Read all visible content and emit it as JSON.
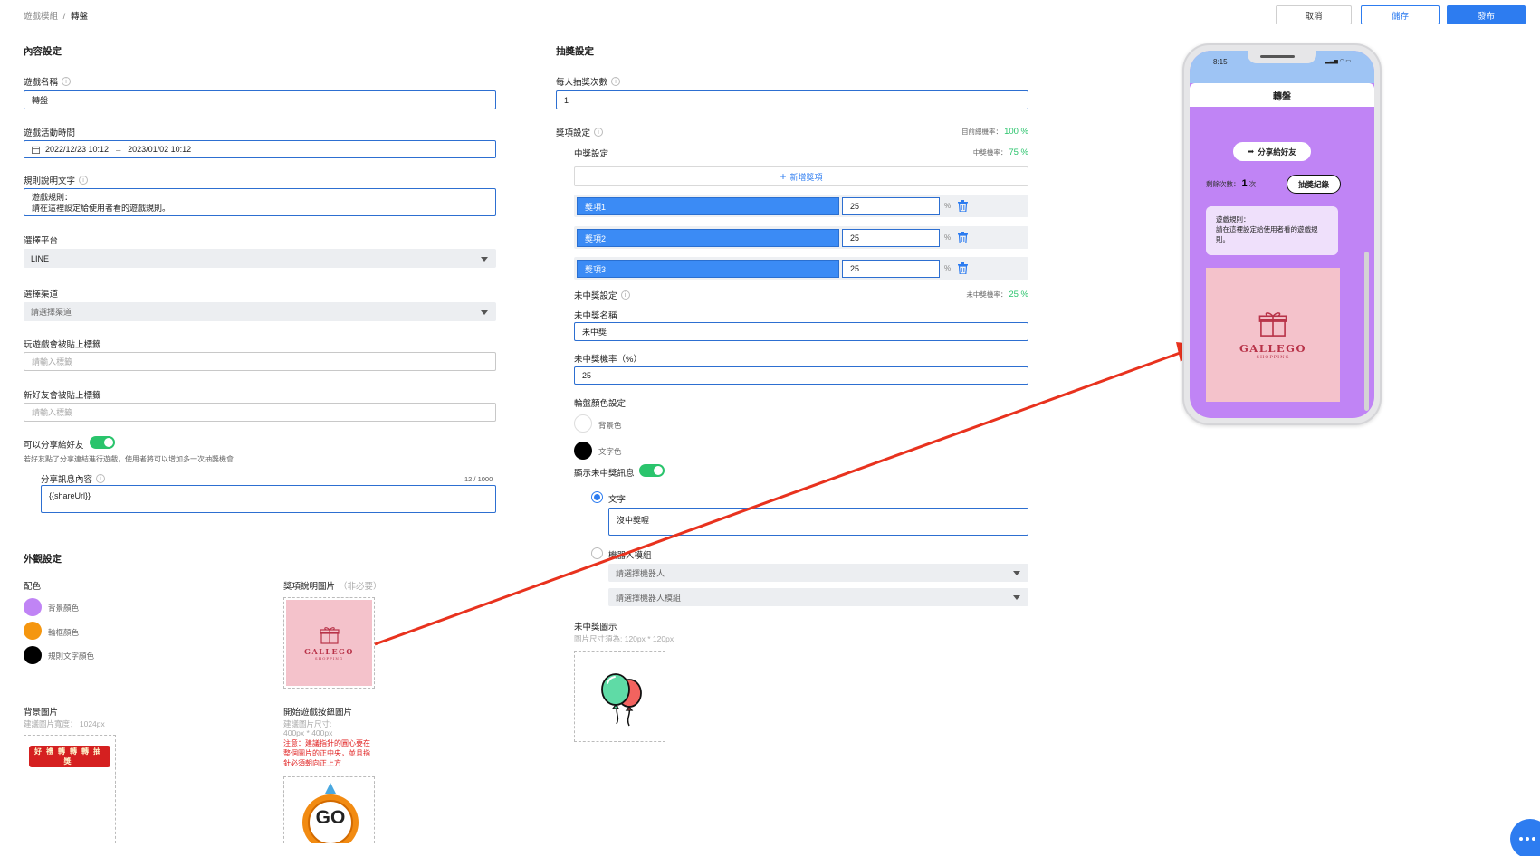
{
  "breadcrumb": {
    "parent": "遊戲模組",
    "separator": "/",
    "current": "轉盤"
  },
  "toolbar": {
    "cancel": "取消",
    "save": "儲存",
    "publish": "發布"
  },
  "content": {
    "section_title": "內容設定",
    "game_name_label": "遊戲名稱",
    "game_name_value": "轉盤",
    "period_label": "遊戲活動時間",
    "period_start": "2022/12/23 10:12",
    "period_arrow": "→",
    "period_end": "2023/01/02 10:12",
    "rules_label": "規則說明文字",
    "rules_line1": "遊戲規則：",
    "rules_line2": "請在這裡設定給使用者看的遊戲規則。",
    "platform_label": "選擇平台",
    "platform_value": "LINE",
    "channel_label": "選擇渠道",
    "channel_placeholder": "請選擇渠道",
    "play_tag_label": "玩遊戲會被貼上標籤",
    "play_tag_placeholder": "請輸入標籤",
    "friend_tag_label": "新好友會被貼上標籤",
    "friend_tag_placeholder": "請輸入標籤",
    "share_label": "可以分享給好友",
    "share_hint": "若好友點了分享連結進行遊戲，使用者將可以增加多一次抽獎機會",
    "share_msg_label": "分享訊息內容",
    "share_msg_count": "12 / 1000",
    "share_msg_value": "{{shareUrl}}"
  },
  "appearance": {
    "section_title": "外觀設定",
    "color_label": "配色",
    "colors": [
      {
        "name": "背景顏色",
        "hex": "#c084f5"
      },
      {
        "name": "輪框顏色",
        "hex": "#f5960f"
      },
      {
        "name": "規則文字顏色",
        "hex": "#000000"
      }
    ],
    "prize_img_label": "獎項說明圖片",
    "prize_img_optional": "（非必要）",
    "bg_img_label": "背景圖片",
    "bg_img_hint": "建議圖片寬度： 1024px",
    "start_btn_label": "開始遊戲按鈕圖片",
    "start_btn_hint1": "建議圖片尺寸:",
    "start_btn_hint2": "400px * 400px",
    "start_btn_note": "注意：建議指針的圓心要在整個圖片的正中央，並且指針必須朝向正上方",
    "gallego_name": "GALLEGO",
    "gallego_sub": "SHOPPING",
    "go_text": "GO",
    "bg_banner": "好禮轉轉轉抽獎"
  },
  "draw": {
    "section_title": "抽獎設定",
    "times_label": "每人抽獎次數",
    "times_value": "1",
    "prize_label": "獎項設定",
    "total_rate_label": "目前總機率：",
    "total_rate_value": "100 %",
    "win_label": "中獎設定",
    "win_rate_label": "中獎機率：",
    "win_rate_value": "75 %",
    "add_prize": "新增獎項",
    "prizes": [
      {
        "name": "獎項1",
        "rate": "25"
      },
      {
        "name": "獎項2",
        "rate": "25"
      },
      {
        "name": "獎項3",
        "rate": "25"
      }
    ],
    "percent": "%",
    "lose_label": "未中獎設定",
    "lose_rate_label": "未中獎機率：",
    "lose_rate_value": "25 %",
    "lose_name_label": "未中獎名稱",
    "lose_name_value": "未中獎",
    "lose_pct_label": "未中獎機率（%）",
    "lose_pct_value": "25",
    "wheel_color_label": "輪盤顏色設定",
    "wheel_bg_label": "背景色",
    "wheel_text_label": "文字色",
    "show_msg_label": "顯示未中獎訊息",
    "radio_text_label": "文字",
    "radio_text_value": "沒中獎喔",
    "radio_bot_label": "機器人模組",
    "bot_placeholder": "請選擇機器人",
    "bot_module_placeholder": "請選擇機器人模組",
    "lose_icon_label": "未中獎圖示",
    "lose_icon_hint": "圖片尺寸須為: 120px * 120px"
  },
  "phone": {
    "time": "8:15",
    "title": "轉盤",
    "share_btn": "分享給好友",
    "remain_label": "剩餘次數：",
    "remain_value": "1",
    "remain_unit": "次",
    "record_btn": "抽獎紀錄",
    "rules_line1": "遊戲規則：",
    "rules_line2": "請在這裡設定給使用者看的遊戲規則。",
    "gallego_name": "GALLEGO",
    "gallego_sub": "SHOPPING"
  },
  "colors": {
    "primary": "#2d7cf0",
    "green": "#2ac46c",
    "arrow": "#e8321e",
    "phone_purple": "#c084f5"
  }
}
